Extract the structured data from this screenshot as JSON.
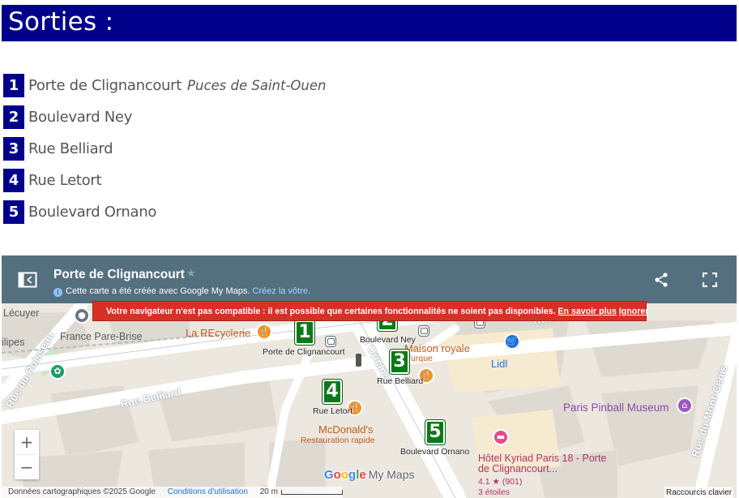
{
  "heading": "Sorties :",
  "exits": [
    {
      "num": "1",
      "name": "Porte de Clignancourt",
      "sub": "Puces de Saint-Ouen"
    },
    {
      "num": "2",
      "name": "Boulevard Ney",
      "sub": ""
    },
    {
      "num": "3",
      "name": "Rue Belliard",
      "sub": ""
    },
    {
      "num": "4",
      "name": "Rue Letort",
      "sub": ""
    },
    {
      "num": "5",
      "name": "Boulevard Ornano",
      "sub": ""
    }
  ],
  "map": {
    "title": "Porte de Clignancourt",
    "info_text": "Cette carte a été créée avec Google My Maps.",
    "create_link": "Créez la vôtre.",
    "warning": {
      "text": "Votre navigateur n'est pas compatible : il est possible que certaines fonctionnalités ne soient pas disponibles.",
      "learn_more": "En savoir plus",
      "ignore": "Ignorer"
    },
    "labels": {
      "lecuyer": "Lécuyer",
      "france_pare_brise": "France Pare-Brise",
      "la_recyclerie": "La REcyclerie",
      "ilipes": "ilipes",
      "rue_du_ruisseau": "Rue du Ruisseau",
      "rue_belliard_road": "Rue Belliard",
      "rue_du_mont_cenis": "Rue du Mont-Cenis",
      "bd_ornano_road": "d Ornano",
      "rue_road": "Rue",
      "maison_royale": "Maison royale",
      "turque": "Turque",
      "lidl": "Lidl",
      "paris_pinball": "Paris Pinball Museum",
      "mcdonalds": "McDonald's",
      "restauration_rapide": "Restauration rapide",
      "hotel_name": "Hôtel Kyriad Paris 18 - Porte de Clignancourt...",
      "hotel_rating": "4.1 ★ (901)",
      "hotel_stars": "3 étoiles"
    },
    "markers": [
      {
        "num": "1",
        "label": "Porte de Clignancourt"
      },
      {
        "num": "2",
        "label": "Boulevard Ney"
      },
      {
        "num": "3",
        "label": "Rue Belliard"
      },
      {
        "num": "4",
        "label": "Rue Letort"
      },
      {
        "num": "5",
        "label": "Boulevard Ornano"
      }
    ],
    "zoom_in": "+",
    "zoom_out": "−",
    "logo": {
      "g1": "G",
      "g2": "o",
      "g3": "o",
      "g4": "g",
      "g5": "l",
      "g6": "e",
      "mymaps": "My Maps"
    },
    "footer": {
      "data": "Données cartographiques ©2025 Google",
      "terms": "Conditions d'utilisation",
      "scale": "20 m",
      "shortcuts": "Raccourcis clavier"
    }
  },
  "colors": {
    "title_bg": "#00008b",
    "marker_green": "#0a7a18",
    "map_header": "#54707f",
    "warning_red": "#d93025"
  }
}
